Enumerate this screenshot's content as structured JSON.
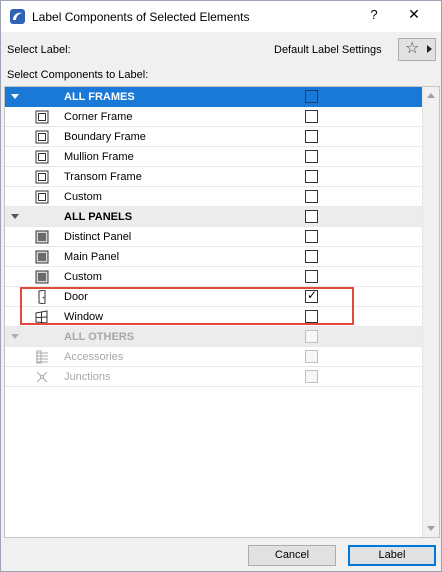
{
  "window": {
    "title": "Label Components of Selected Elements",
    "help": "?",
    "close": "✕"
  },
  "top": {
    "select_label": "Select Label:",
    "default_label": "Default Label Settings",
    "star_glyph": "☆",
    "components_label": "Select Components to Label:"
  },
  "rows": [
    {
      "label": "ALL FRAMES",
      "type": "group",
      "checked": false,
      "state": "selected"
    },
    {
      "label": "Corner Frame",
      "type": "item",
      "icon": "frame-icon",
      "checked": false
    },
    {
      "label": "Boundary Frame",
      "type": "item",
      "icon": "frame-icon",
      "checked": false
    },
    {
      "label": "Mullion Frame",
      "type": "item",
      "icon": "frame-icon",
      "checked": false
    },
    {
      "label": "Transom Frame",
      "type": "item",
      "icon": "frame-icon",
      "checked": false
    },
    {
      "label": "Custom",
      "type": "item",
      "icon": "frame-icon",
      "checked": false
    },
    {
      "label": "ALL PANELS",
      "type": "group",
      "checked": false
    },
    {
      "label": "Distinct Panel",
      "type": "item",
      "icon": "panel-icon",
      "checked": false
    },
    {
      "label": "Main Panel",
      "type": "item",
      "icon": "panel-icon",
      "checked": false
    },
    {
      "label": "Custom",
      "type": "item",
      "icon": "panel-icon",
      "checked": false
    },
    {
      "label": "Door",
      "type": "item",
      "icon": "door-icon",
      "checked": true
    },
    {
      "label": "Window",
      "type": "item",
      "icon": "window-icon",
      "checked": false
    },
    {
      "label": "ALL OTHERS",
      "type": "group",
      "checked": false,
      "state": "disabled"
    },
    {
      "label": "Accessories",
      "type": "item",
      "icon": "accessories-icon",
      "checked": false,
      "state": "disabled"
    },
    {
      "label": "Junctions",
      "type": "item",
      "icon": "junctions-icon",
      "checked": false,
      "state": "disabled"
    }
  ],
  "buttons": {
    "cancel": "Cancel",
    "ok": "Label"
  },
  "colors": {
    "selection": "#1a78d7",
    "highlight_box": "#e04a3f"
  }
}
